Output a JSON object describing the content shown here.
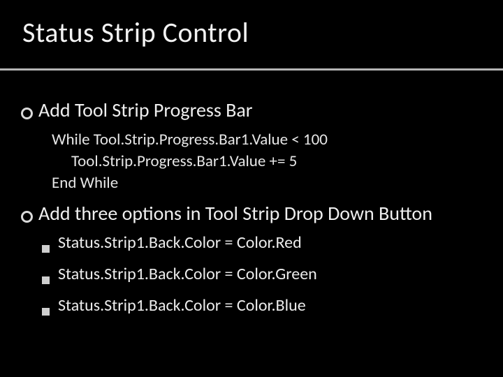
{
  "title": "Status Strip Control",
  "bullets": {
    "b1": "Add Tool Strip Progress Bar",
    "code": {
      "l1": "While Tool.Strip.Progress.Bar1.Value < 100",
      "l2": "Tool.Strip.Progress.Bar1.Value += 5",
      "l3": "End While"
    },
    "b2": "Add three options in Tool Strip Drop Down Button",
    "sub": {
      "s1": "Status.Strip1.Back.Color = Color.Red",
      "s2": "Status.Strip1.Back.Color = Color.Green",
      "s3": "Status.Strip1.Back.Color = Color.Blue"
    }
  }
}
